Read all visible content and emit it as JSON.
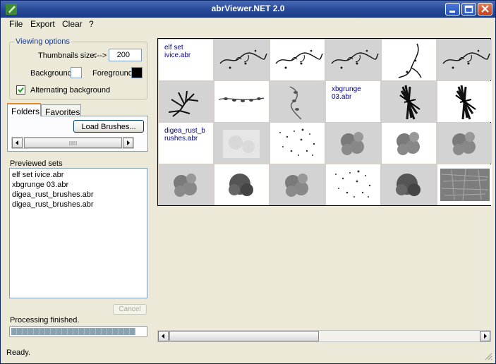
{
  "window": {
    "title": "abrViewer.NET 2.0"
  },
  "menu": {
    "items": [
      "File",
      "Export",
      "Clear",
      "?"
    ]
  },
  "viewing_options": {
    "legend": "Viewing options",
    "thumb_label": "Thumbnails size:",
    "arrows": "<-->",
    "thumb_value": "200",
    "bg_label": "Background:",
    "fg_label": "Foreground:",
    "bg_color": "#ffffff",
    "fg_color": "#000000",
    "alt_label": "Alternating background",
    "alt_checked": true
  },
  "tabs": [
    "Folders",
    "Favorites"
  ],
  "load_button": "Load Brushes...",
  "previewed": {
    "label": "Previewed sets",
    "items": [
      "elf set ivice.abr",
      "xbgrunge 03.abr",
      "digea_rust_brushes.abr",
      "digea_rust_brushes.abr"
    ]
  },
  "cancel_button": "Cancel",
  "progress": {
    "label": "Processing finished.",
    "value": 0.93
  },
  "status": "Ready.",
  "grid": {
    "rows": [
      [
        {
          "type": "label",
          "text": "elf set ivice.abr"
        },
        {
          "type": "brush",
          "icon": "vine-swirl-brush"
        },
        {
          "type": "brush",
          "icon": "vine-swirl-brush"
        },
        {
          "type": "brush",
          "icon": "vine-swirl-brush"
        },
        {
          "type": "brush",
          "icon": "vine-curl-brush"
        },
        {
          "type": "brush",
          "icon": "vine-swirl-brush"
        }
      ],
      [
        {
          "type": "brush",
          "icon": "branch-brush"
        },
        {
          "type": "brush",
          "icon": "leaf-vine-brush"
        },
        {
          "type": "brush",
          "icon": "leaf-curl-brush"
        },
        {
          "type": "label",
          "text": "xbgrunge 03.abr"
        },
        {
          "type": "brush",
          "icon": "grunge-scratch-brush"
        },
        {
          "type": "brush",
          "icon": "grunge-scratch-brush"
        }
      ],
      [
        {
          "type": "label",
          "text": "digea_rust_b rushes.abr"
        },
        {
          "type": "brush",
          "icon": "rust-faint-brush"
        },
        {
          "type": "brush",
          "icon": "rust-speckle-brush"
        },
        {
          "type": "brush",
          "icon": "rust-blot-brush"
        },
        {
          "type": "brush",
          "icon": "rust-blot-brush"
        },
        {
          "type": "brush",
          "icon": "rust-blot-brush"
        }
      ],
      [
        {
          "type": "brush",
          "icon": "rust-blot-brush"
        },
        {
          "type": "brush",
          "icon": "rust-dark-brush"
        },
        {
          "type": "brush",
          "icon": "rust-blot-brush"
        },
        {
          "type": "brush",
          "icon": "rust-speckle-brush"
        },
        {
          "type": "brush",
          "icon": "rust-dark-brush"
        },
        {
          "type": "brush",
          "icon": "rust-texture-brush"
        }
      ]
    ]
  }
}
